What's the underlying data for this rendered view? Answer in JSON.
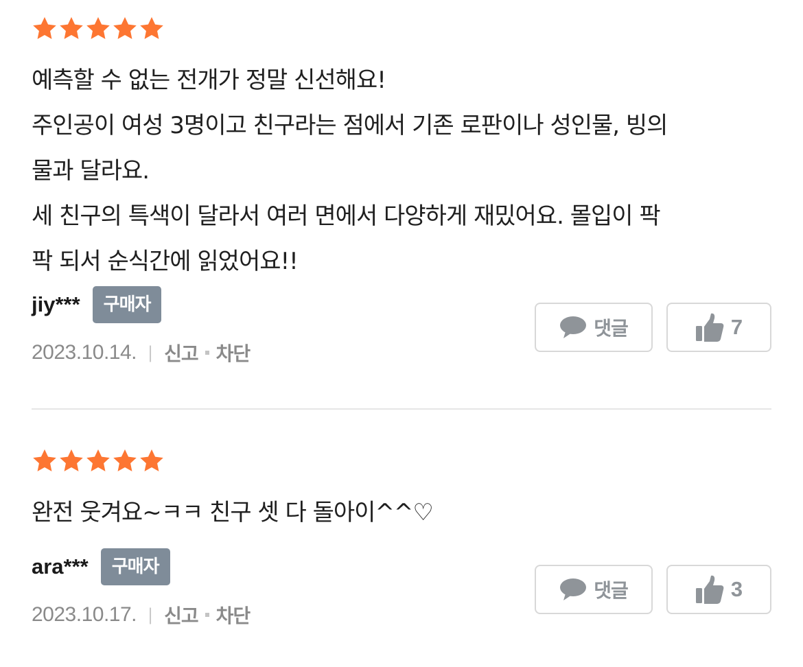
{
  "colors": {
    "star": "#fd7632",
    "badge_bg": "#7f8c99",
    "muted_text": "#8a8a8a",
    "button_border": "#d8d8d8",
    "button_text": "#8f9499"
  },
  "reviews": [
    {
      "rating": 5,
      "text_lines": [
        "예측할 수 없는 전개가 정말 신선해요!",
        "주인공이 여성 3명이고 친구라는 점에서 기존 로판이나 성인물, 빙의",
        "물과 달라요.",
        "세 친구의 특색이 달라서 여러 면에서 다양하게 재밌어요. 몰입이 팍",
        "팍 되서 순식간에 읽었어요!!"
      ],
      "author": "jiy***",
      "badge": "구매자",
      "date": "2023.10.14.",
      "report_label": "신고",
      "block_label": "차단",
      "comment_label": "댓글",
      "like_count": "7",
      "comment_icon": "speech-bubble-icon",
      "like_icon": "thumbs-up-icon"
    },
    {
      "rating": 5,
      "text_lines": [
        "완전 웃겨요~ㅋㅋ 친구 셋 다 돌아이^^♡"
      ],
      "author": "ara***",
      "badge": "구매자",
      "date": "2023.10.17.",
      "report_label": "신고",
      "block_label": "차단",
      "comment_label": "댓글",
      "like_count": "3",
      "comment_icon": "speech-bubble-icon",
      "like_icon": "thumbs-up-icon"
    }
  ]
}
